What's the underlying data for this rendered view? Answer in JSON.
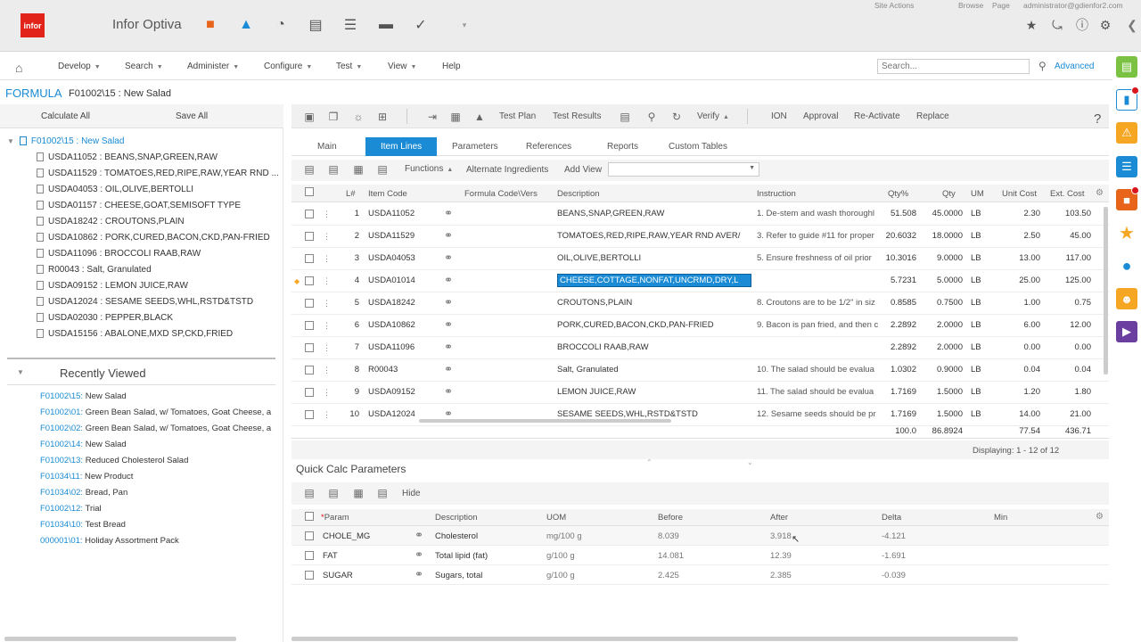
{
  "app": {
    "logo": "infor",
    "title": "Infor Optiva"
  },
  "topright": {
    "site_actions": "Site Actions",
    "browse": "Browse",
    "page": "Page",
    "user": "administrator@gdienfor2.com"
  },
  "menu": {
    "items": [
      "Develop",
      "Search",
      "Administer",
      "Configure",
      "Test",
      "View",
      "Help"
    ],
    "search_placeholder": "Search...",
    "advanced": "Advanced"
  },
  "breadcrumb": {
    "type": "FORMULA",
    "title": "F01002\\15 : New Salad"
  },
  "left": {
    "calculate_all": "Calculate All",
    "save_all": "Save All",
    "tree_root": "F01002\\15 : New Salad",
    "tree_items": [
      "USDA11052 : BEANS,SNAP,GREEN,RAW",
      "USDA11529 : TOMATOES,RED,RIPE,RAW,YEAR RND ...",
      "USDA04053 : OIL,OLIVE,BERTOLLI",
      "USDA01157 : CHEESE,GOAT,SEMISOFT TYPE",
      "USDA18242 : CROUTONS,PLAIN",
      "USDA10862 : PORK,CURED,BACON,CKD,PAN-FRIED",
      "USDA11096 : BROCCOLI RAAB,RAW",
      "R00043 : Salt, Granulated",
      "USDA09152 : LEMON JUICE,RAW",
      "USDA12024 : SESAME SEEDS,WHL,RSTD&TSTD",
      "USDA02030 : PEPPER,BLACK",
      "USDA15156 : ABALONE,MXD SP,CKD,FRIED"
    ],
    "recently_viewed_title": "Recently Viewed",
    "recent": [
      "F01002\\15: New Salad",
      "F01002\\01: Green Bean Salad, w/ Tomatoes, Goat Cheese, a",
      "F01002\\02: Green Bean Salad, w/ Tomatoes, Goat Cheese, a",
      "F01002\\14: New Salad",
      "F01002\\13: Reduced Cholesterol Salad",
      "F01034\\11: New Product",
      "F01034\\02: Bread, Pan",
      "F01002\\12: Trial",
      "F01034\\10: Test Bread",
      "000001\\01: Holiday Assortment Pack"
    ]
  },
  "toolbar": {
    "test_plan": "Test Plan",
    "test_results": "Test Results",
    "verify": "Verify",
    "ion": "ION",
    "approval": "Approval",
    "reactivate": "Re-Activate",
    "replace": "Replace",
    "help": "?"
  },
  "tabs": [
    "Main",
    "Item Lines",
    "Parameters",
    "References",
    "Reports",
    "Custom Tables"
  ],
  "subbar": {
    "functions": "Functions",
    "alternate": "Alternate Ingredients",
    "add_view": "Add View"
  },
  "grid": {
    "headers": {
      "line": "L#",
      "item_code": "Item Code",
      "formula_code": "Formula Code\\Vers",
      "description": "Description",
      "instruction": "Instruction",
      "qty_pct": "Qty%",
      "qty": "Qty",
      "um": "UM",
      "unit_cost": "Unit Cost",
      "ext_cost": "Ext. Cost"
    },
    "rows": [
      {
        "n": "1",
        "code": "USDA11052",
        "desc": "BEANS,SNAP,GREEN,RAW",
        "instr": "1. De-stem and wash thoroughl",
        "qpct": "51.508",
        "qty": "45.0000",
        "um": "LB",
        "uc": "2.30",
        "ec": "103.50"
      },
      {
        "n": "2",
        "code": "USDA11529",
        "desc": "TOMATOES,RED,RIPE,RAW,YEAR RND AVER/",
        "instr": "3. Refer to guide #11 for proper",
        "qpct": "20.6032",
        "qty": "18.0000",
        "um": "LB",
        "uc": "2.50",
        "ec": "45.00"
      },
      {
        "n": "3",
        "code": "USDA04053",
        "desc": "OIL,OLIVE,BERTOLLI",
        "instr": "5. Ensure freshness of oil prior",
        "qpct": "10.3016",
        "qty": "9.0000",
        "um": "LB",
        "uc": "13.00",
        "ec": "117.00"
      },
      {
        "n": "4",
        "code": "USDA01014",
        "desc": "CHEESE,COTTAGE,NONFAT,UNCRMD,DRY,L",
        "instr": "",
        "qpct": "5.7231",
        "qty": "5.0000",
        "um": "LB",
        "uc": "25.00",
        "ec": "125.00"
      },
      {
        "n": "5",
        "code": "USDA18242",
        "desc": "CROUTONS,PLAIN",
        "instr": "8. Croutons are to be 1/2\" in siz",
        "qpct": "0.8585",
        "qty": "0.7500",
        "um": "LB",
        "uc": "1.00",
        "ec": "0.75"
      },
      {
        "n": "6",
        "code": "USDA10862",
        "desc": "PORK,CURED,BACON,CKD,PAN-FRIED",
        "instr": "9. Bacon is pan fried, and then c",
        "qpct": "2.2892",
        "qty": "2.0000",
        "um": "LB",
        "uc": "6.00",
        "ec": "12.00"
      },
      {
        "n": "7",
        "code": "USDA11096",
        "desc": "BROCCOLI RAAB,RAW",
        "instr": "",
        "qpct": "2.2892",
        "qty": "2.0000",
        "um": "LB",
        "uc": "0.00",
        "ec": "0.00"
      },
      {
        "n": "8",
        "code": "R00043",
        "desc": "Salt, Granulated",
        "instr": "10. The salad should be evalua",
        "qpct": "1.0302",
        "qty": "0.9000",
        "um": "LB",
        "uc": "0.04",
        "ec": "0.04"
      },
      {
        "n": "9",
        "code": "USDA09152",
        "desc": "LEMON JUICE,RAW",
        "instr": "11. The salad should be evalua",
        "qpct": "1.7169",
        "qty": "1.5000",
        "um": "LB",
        "uc": "1.20",
        "ec": "1.80"
      },
      {
        "n": "10",
        "code": "USDA12024",
        "desc": "SESAME SEEDS,WHL,RSTD&TSTD",
        "instr": "12. Sesame seeds should be pr",
        "qpct": "1.7169",
        "qty": "1.5000",
        "um": "LB",
        "uc": "14.00",
        "ec": "21.00"
      }
    ],
    "totals": {
      "qpct": "100.0",
      "qty": "86.8924",
      "uc": "77.54",
      "ec": "436.71"
    },
    "displaying": "Displaying: 1 - 12 of 12"
  },
  "quick": {
    "title": "Quick Calc Parameters",
    "hide": "Hide",
    "headers": {
      "param": "Param",
      "description": "Description",
      "uom": "UOM",
      "before": "Before",
      "after": "After",
      "delta": "Delta",
      "min": "Min"
    },
    "rows": [
      {
        "param": "CHOLE_MG",
        "desc": "Cholesterol",
        "uom": "mg/100 g",
        "before": "8.039",
        "after": "3.918",
        "delta": "-4.121"
      },
      {
        "param": "FAT",
        "desc": "Total lipid (fat)",
        "uom": "g/100 g",
        "before": "14.081",
        "after": "12.39",
        "delta": "-1.691"
      },
      {
        "param": "SUGAR",
        "desc": "Sugars, total",
        "uom": "g/100 g",
        "before": "2.425",
        "after": "2.385",
        "delta": "-0.039"
      }
    ]
  },
  "colors": {
    "accent": "#1a8bd4",
    "brand": "#e2231a"
  }
}
